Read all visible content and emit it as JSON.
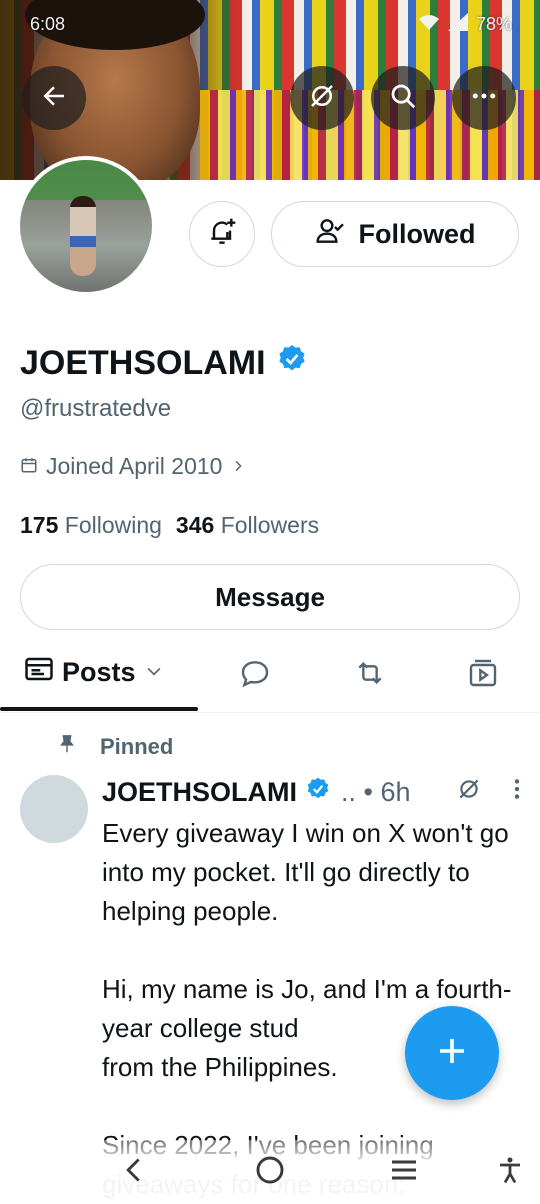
{
  "status_bar": {
    "time": "6:08",
    "battery": "78%"
  },
  "profile": {
    "display_name": "JOETHSOLAMI",
    "handle": "@frustratedve",
    "joined": "Joined April 2010",
    "following_count": "175",
    "following_label": "Following",
    "followers_count": "346",
    "followers_label": "Followers",
    "followed_label": "Followed",
    "message_label": "Message"
  },
  "tabs": {
    "posts_label": "Posts"
  },
  "post": {
    "pinned_label": "Pinned",
    "author": "JOETHSOLAMI",
    "meta": ".. • 6h",
    "text": "Every giveaway I win on X won't go into my pocket. It'll go directly to helping people.\n\nHi, my name is Jo, and I'm a fourth-year college stud\nfrom the Philippines.\n\nSince 2022, I've been joining giveaways for one reason:"
  },
  "colors": {
    "accent": "#1d9bf0",
    "text": "#0f1419",
    "secondary": "#536471",
    "border": "#cfd9de"
  },
  "icons": [
    "back-arrow-icon",
    "grok-icon",
    "search-icon",
    "more-icon",
    "bell-plus-icon",
    "person-check-icon",
    "verified-icon",
    "calendar-icon",
    "chevron-right-icon",
    "posts-tab-icon",
    "chevron-down-icon",
    "reply-icon",
    "repost-icon",
    "video-icon",
    "pin-icon",
    "plus-icon",
    "nav-back-icon",
    "nav-home-icon",
    "nav-recents-icon",
    "accessibility-icon"
  ]
}
